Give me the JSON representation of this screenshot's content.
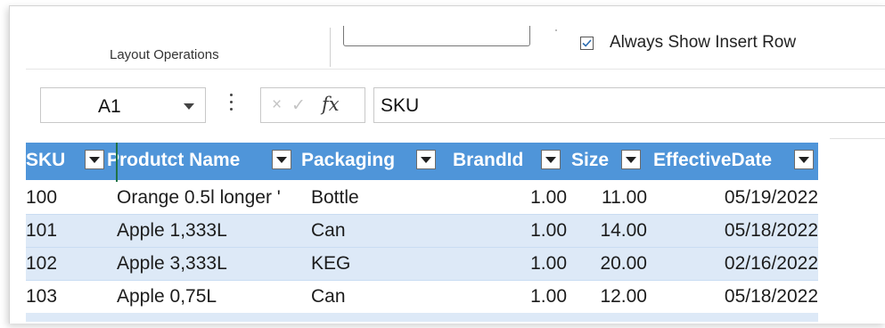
{
  "ribbon": {
    "group_label": "Layout Operations",
    "always_show_insert_row": {
      "label": "Always Show Insert Row",
      "checked": true
    }
  },
  "formula_bar": {
    "name_box": "A1",
    "cancel_icon": "×",
    "enter_icon": "✓",
    "function_icon": "fx",
    "formula": "SKU"
  },
  "table": {
    "header_color": "#4f95d9",
    "band_color": "#dde9f7",
    "columns": [
      {
        "label": "SKU"
      },
      {
        "label": "Produtct Name"
      },
      {
        "label": "Packaging"
      },
      {
        "label": "BrandId"
      },
      {
        "label": "Size"
      },
      {
        "label": "EffectiveDate"
      }
    ],
    "rows": [
      [
        "100",
        "Orange 0.5l longer '",
        "Bottle",
        "1.00",
        "11.00",
        "05/19/2022"
      ],
      [
        "101",
        "Apple 1,333L",
        "Can",
        "1.00",
        "14.00",
        "05/18/2022"
      ],
      [
        "102",
        "Apple 3,333L",
        "KEG",
        "1.00",
        "20.00",
        "02/16/2022"
      ],
      [
        "103",
        "Apple 0,75L",
        "Can",
        "1.00",
        "12.00",
        "05/18/2022"
      ]
    ]
  }
}
